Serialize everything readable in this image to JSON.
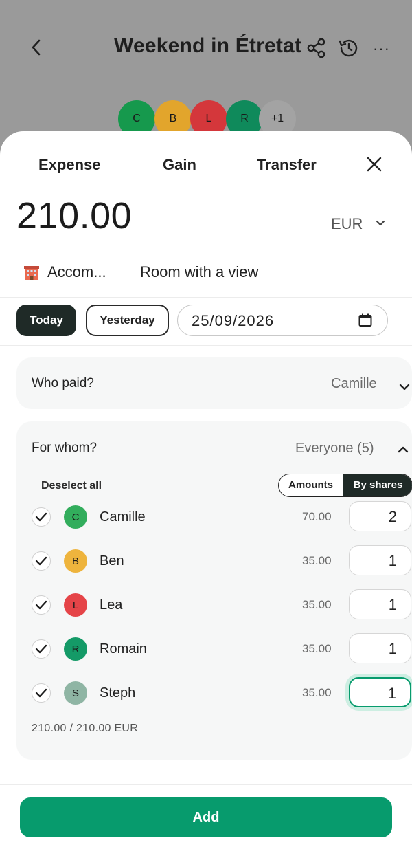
{
  "header": {
    "title": "Weekend in Étretat",
    "members": [
      {
        "initial": "C",
        "color": "#16994d"
      },
      {
        "initial": "B",
        "color": "#e2a52c"
      },
      {
        "initial": "L",
        "color": "#d4373b"
      },
      {
        "initial": "R",
        "color": "#0f8a5b"
      }
    ],
    "more_count": "+1",
    "more_color": "#a3a3a3"
  },
  "tabs": [
    "Expense",
    "Gain",
    "Transfer"
  ],
  "amount": "210.00",
  "currency": "EUR",
  "category": {
    "label": "Accom...",
    "icon": "hotel-emoji"
  },
  "description": "Room with a view",
  "date_chips": {
    "today": "Today",
    "yesterday": "Yesterday"
  },
  "date_value": "25/09/2026",
  "who_paid": {
    "label": "Who paid?",
    "value": "Camille"
  },
  "for_whom": {
    "label": "For whom?",
    "value": "Everyone (5)",
    "deselect_label": "Deselect all",
    "mode_amounts": "Amounts",
    "mode_shares": "By shares",
    "participants": [
      {
        "initial": "C",
        "name": "Camille",
        "amount": "70.00",
        "shares": "2",
        "color": "#32ad5c"
      },
      {
        "initial": "B",
        "name": "Ben",
        "amount": "35.00",
        "shares": "1",
        "color": "#eeb43d"
      },
      {
        "initial": "L",
        "name": "Lea",
        "amount": "35.00",
        "shares": "1",
        "color": "#e54448"
      },
      {
        "initial": "R",
        "name": "Romain",
        "amount": "35.00",
        "shares": "1",
        "color": "#149a67"
      },
      {
        "initial": "S",
        "name": "Steph",
        "amount": "35.00",
        "shares": "1",
        "color": "#8fb5a4"
      }
    ],
    "total": "210.00 / 210.00 EUR"
  },
  "add_label": "Add",
  "colors": {
    "accent": "#079b6d",
    "dark_chip": "#1f2a27"
  }
}
